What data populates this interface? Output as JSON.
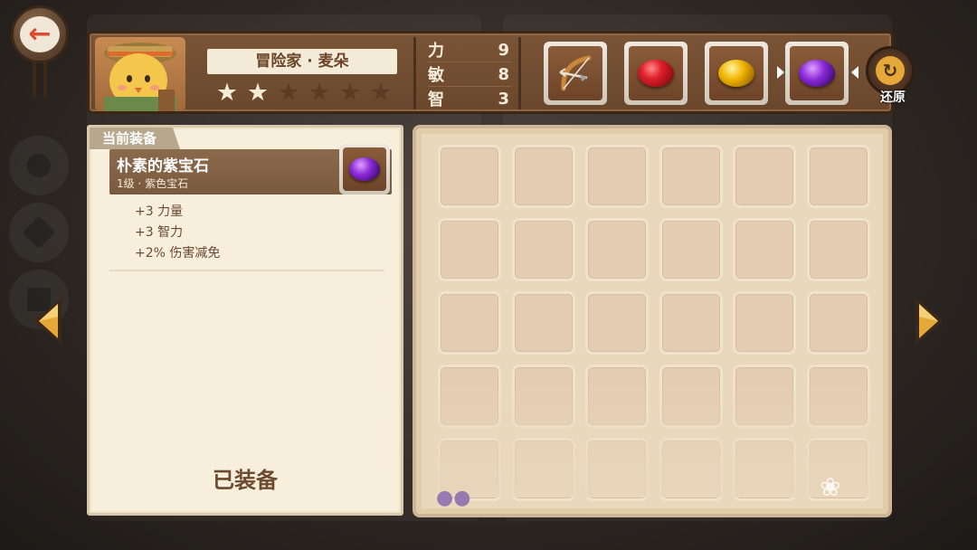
{
  "header": {
    "character_name": "冒险家 · 麦朵",
    "stars": {
      "filled": 2,
      "total": 6
    },
    "stats": [
      {
        "label": "力",
        "value": "9"
      },
      {
        "label": "敏",
        "value": "8"
      },
      {
        "label": "智",
        "value": "3"
      }
    ],
    "slots": [
      {
        "icon": "bow-icon"
      },
      {
        "icon": "red-gem-icon",
        "color": "#e0202a"
      },
      {
        "icon": "yellow-gem-icon",
        "color": "#f0b400"
      },
      {
        "icon": "purple-gem-icon",
        "color": "#8a2ad8",
        "selected": true
      }
    ],
    "restore_label": "还原"
  },
  "equipment_panel": {
    "tab_label": "当前装备",
    "item": {
      "name": "朴素的紫宝石",
      "subtitle": "1级 · 紫色宝石",
      "icon": "purple-gem-icon"
    },
    "attributes": [
      "+3  力量",
      "+3  智力",
      "+2%  伤害减免"
    ],
    "status_label": "已装备"
  },
  "inventory": {
    "rows": 5,
    "columns": 6
  },
  "icons": {
    "back": "back-arrow-icon",
    "prev": "left-arrow-icon",
    "next": "right-arrow-icon"
  },
  "colors": {
    "accent": "#e7a83a",
    "panel": "#f7eedb",
    "header": "#7a5436"
  }
}
